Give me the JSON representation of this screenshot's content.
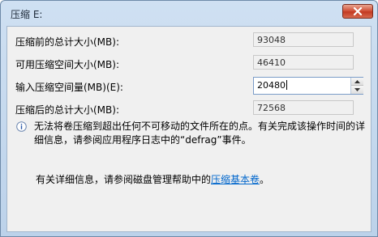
{
  "window": {
    "title": "压缩 E:",
    "close_icon": "close-icon"
  },
  "fields": {
    "total_before": {
      "label": "压缩前的总计大小(MB):",
      "value": "93048"
    },
    "available": {
      "label": "可用压缩空间大小(MB):",
      "value": "46410"
    },
    "shrink_amount": {
      "label": "输入压缩空间量(MB)(E):",
      "value": "20480"
    },
    "total_after": {
      "label": "压缩后的总计大小(MB):",
      "value": "72568"
    }
  },
  "info": {
    "icon": "info-icon",
    "text": "无法将卷压缩到超出任何不可移动的文件所在的点。有关完成该操作时间的详细信息，请参阅应用程序日志中的“defrag”事件。"
  },
  "help": {
    "prefix": "有关详细信息，请参阅磁盘管理帮助中的",
    "link": "压缩基本卷",
    "suffix": "。"
  }
}
